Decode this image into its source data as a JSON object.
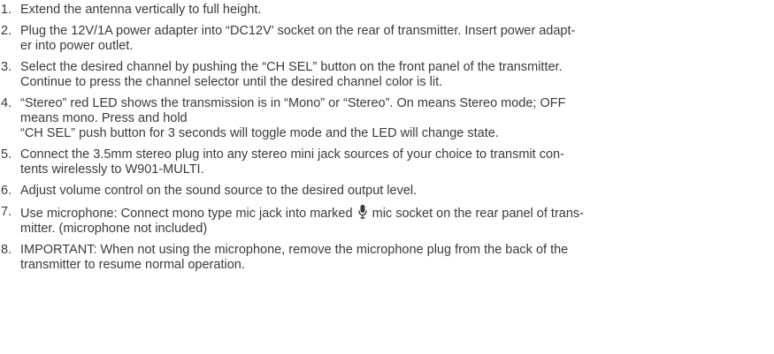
{
  "steps": [
    {
      "number": "1.",
      "lines": [
        "Extend the antenna vertically to full height."
      ]
    },
    {
      "number": "2.",
      "lines": [
        "Plug the 12V/1A power adapter into “DC12V’ socket on the rear of transmitter. Insert power adapt-",
        "er into power outlet."
      ]
    },
    {
      "number": "3.",
      "lines": [
        "Select the desired channel by pushing the “CH SEL” button on the front panel of the transmitter.",
        "Continue to press the channel selector until the desired channel color is lit."
      ]
    },
    {
      "number": "4.",
      "lines": [
        "“Stereo” red LED shows the transmission is in “Mono” or “Stereo”.    On means Stereo mode; OFF",
        "means mono. Press and hold",
        "“CH SEL” push button for 3 seconds will toggle mode and the LED will change state."
      ]
    },
    {
      "number": "5.",
      "lines": [
        "Connect the 3.5mm stereo plug into any stereo mini jack sources of your choice to transmit con-",
        "tents wirelessly to W901-MULTI."
      ]
    },
    {
      "number": "6.",
      "lines": [
        "Adjust volume control on the sound source to the desired output level."
      ]
    },
    {
      "number": "7.",
      "line1_before_icon": "Use microphone: Connect mono type mic jack into marked",
      "line1_after_icon": "mic socket on the rear panel of trans-",
      "line2": "mitter. (microphone not included)",
      "icon": "microphone-icon"
    },
    {
      "number": "8.",
      "lines": [
        "IMPORTANT: When not using the microphone, remove the microphone plug from the back of the",
        "transmitter to resume normal operation."
      ]
    }
  ]
}
